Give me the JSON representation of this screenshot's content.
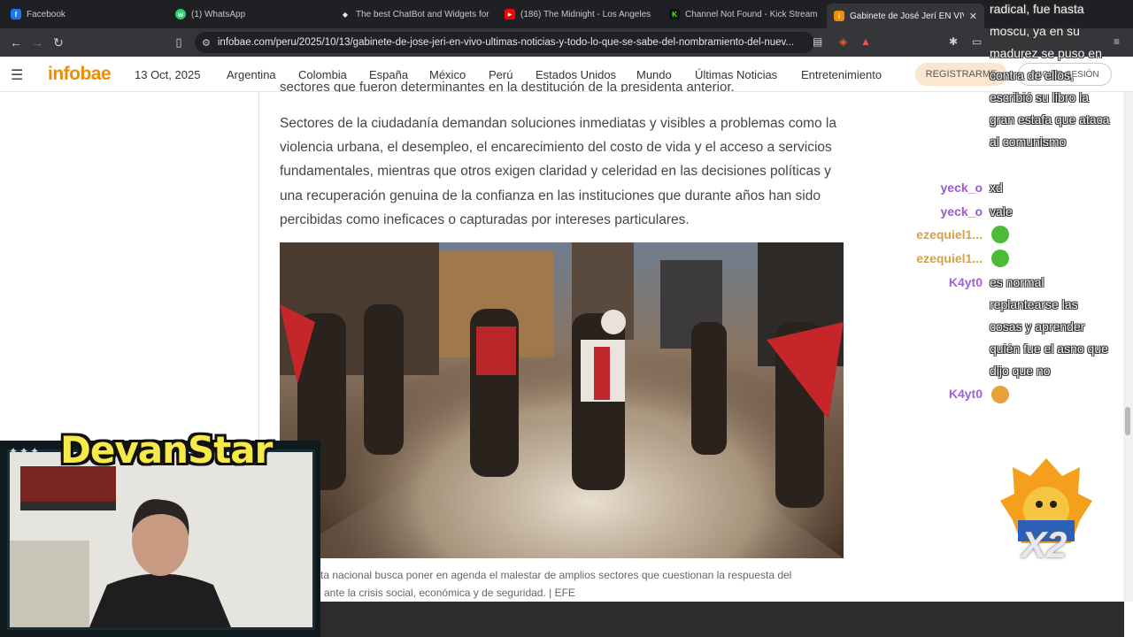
{
  "browser": {
    "tabs": [
      {
        "title": "Facebook",
        "color": "#1877f2",
        "glyph": "f"
      },
      {
        "title": "(1) WhatsApp",
        "color": "#25d366",
        "glyph": "w"
      },
      {
        "title": "The best ChatBot and Widgets for",
        "color": "#e8e8e8",
        "glyph": "◆"
      },
      {
        "title": "(186) The Midnight - Los Angeles",
        "color": "#ff0000",
        "glyph": "▶"
      },
      {
        "title": "Channel Not Found - Kick Stream",
        "color": "#53fc18",
        "glyph": "K"
      },
      {
        "title": "Gabinete de José Jerí EN VIVO",
        "color": "#f28c00",
        "glyph": "i",
        "active": true
      }
    ],
    "url": "infobae.com/peru/2025/10/13/gabinete-de-jose-jeri-en-vivo-ultimas-noticias-y-todo-lo-que-se-sabe-del-nombramiento-del-nuev..."
  },
  "site": {
    "logo": "infobae",
    "date": "13 Oct, 2025",
    "nav": [
      "Argentina",
      "Colombia",
      "España",
      "México",
      "Perú",
      "Estados Unidos",
      "Mundo",
      "Últimas Noticias",
      "Entretenimiento"
    ],
    "register": "REGISTRARME",
    "login": "INICIAR SESIÓN"
  },
  "article": {
    "prev_line": "sectores que fueron determinantes en la destitución de la presidenta anterior.",
    "paragraph": "Sectores de la ciudadanía demandan soluciones inmediatas y visibles a problemas como la violencia urbana, el desempleo, el encarecimiento del costo de vida y el acceso a servicios fundamentales, mientras que otros exigen claridad y celeridad en las decisiones políticas y una recuperación genuina de la confianza en las instituciones que durante años han sido percibidas como ineficaces o capturadas por intereses particulares.",
    "caption_line1": "sta nacional busca poner en agenda el malestar de amplios sectores que cuestionan la respuesta del",
    "caption_line2": "o ante la crisis social, económica y de seguridad. | EFE"
  },
  "overlay": {
    "streamer": "DevanStar",
    "badge_text": "X2",
    "chat": {
      "top_message": "radical, fue hasta moscu, ya en su madurez se puso en contra de ellos, escribió su libro la gran estafa que ataca al comunismo",
      "lines": [
        {
          "user": "yeck_o",
          "color": "#9b59d0",
          "message": "xd"
        },
        {
          "user": "yeck_o",
          "color": "#9b59d0",
          "message": "vale"
        },
        {
          "user": "ezequiel1...",
          "color": "#d4a04a",
          "message": ""
        },
        {
          "user": "ezequiel1...",
          "color": "#d4a04a",
          "message": ""
        },
        {
          "user": "K4yt0",
          "color": "#a25fe0",
          "message": "es normal replantearse las cosas y aprender quién fue el asno que dijo que no"
        },
        {
          "user": "K4yt0",
          "color": "#a25fe0",
          "message": ""
        }
      ]
    }
  }
}
